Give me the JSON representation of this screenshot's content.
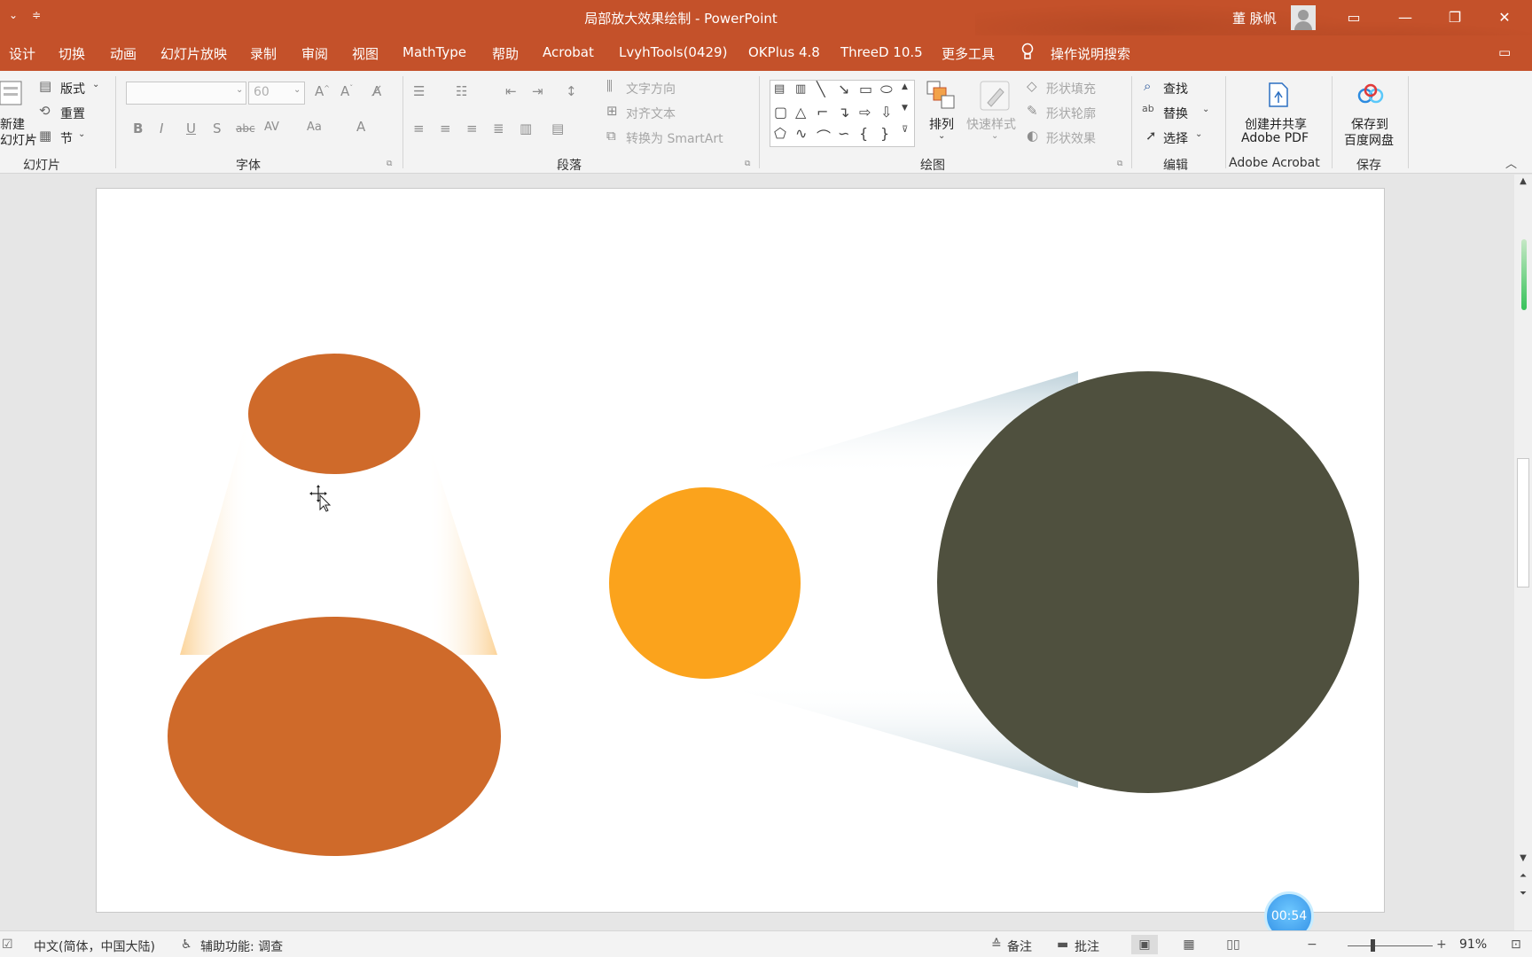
{
  "window": {
    "title": "局部放大效果绘制 - PowerPoint",
    "user": "董 脉帆",
    "buttons": {
      "minimize": "—",
      "restore": "❐",
      "close": "✕",
      "ribbon_display": "▭"
    }
  },
  "tabs": [
    "设计",
    "切换",
    "动画",
    "幻灯片放映",
    "录制",
    "审阅",
    "视图",
    "MathType",
    "帮助",
    "Acrobat",
    "LvyhTools(0429)",
    "OKPlus 4.8",
    "ThreeD 10.5",
    "更多工具",
    "操作说明搜索"
  ],
  "ribbon": {
    "slides": {
      "new_slide_line1": "新建",
      "new_slide_line2": "幻灯片",
      "layout": "版式",
      "reset": "重置",
      "section": "节",
      "group_label": "幻灯片"
    },
    "font": {
      "font_name": "",
      "font_size": "60",
      "group_label": "字体",
      "bold": "B",
      "italic": "I",
      "underline": "U",
      "shadow": "S",
      "strike": "abc",
      "spacing": "AV",
      "case": "Aa",
      "color": "A"
    },
    "paragraph": {
      "text_direction": "文字方向",
      "align_text": "对齐文本",
      "smartart": "转换为 SmartArt",
      "group_label": "段落"
    },
    "drawing": {
      "arrange": "排列",
      "quick_styles": "快速样式",
      "shape_fill": "形状填充",
      "shape_outline": "形状轮廓",
      "shape_effects": "形状效果",
      "group_label": "绘图"
    },
    "editing": {
      "find": "查找",
      "replace": "替换",
      "select": "选择",
      "group_label": "编辑"
    },
    "acrobat": {
      "line1": "创建并共享",
      "line2": "Adobe PDF",
      "group_label": "Adobe Acrobat"
    },
    "save": {
      "line1": "保存到",
      "line2": "百度网盘",
      "group_label": "保存"
    }
  },
  "slide_shapes": {
    "colors": {
      "cone_orange": "#cf6a2a",
      "small_circle": "#fba31c",
      "big_circle": "#4f503e",
      "cone_glow": "#fbd9a6",
      "beam_glow": "#c8d8e0"
    }
  },
  "timer": "00:54",
  "status": {
    "language": "中文(简体，中国大陆)",
    "accessibility": "辅助功能: 调查",
    "notes": "备注",
    "comments": "批注",
    "zoom": "91%"
  },
  "colors": {
    "accent": "#c4512a",
    "ribbon_bg": "#f3f3f3"
  }
}
